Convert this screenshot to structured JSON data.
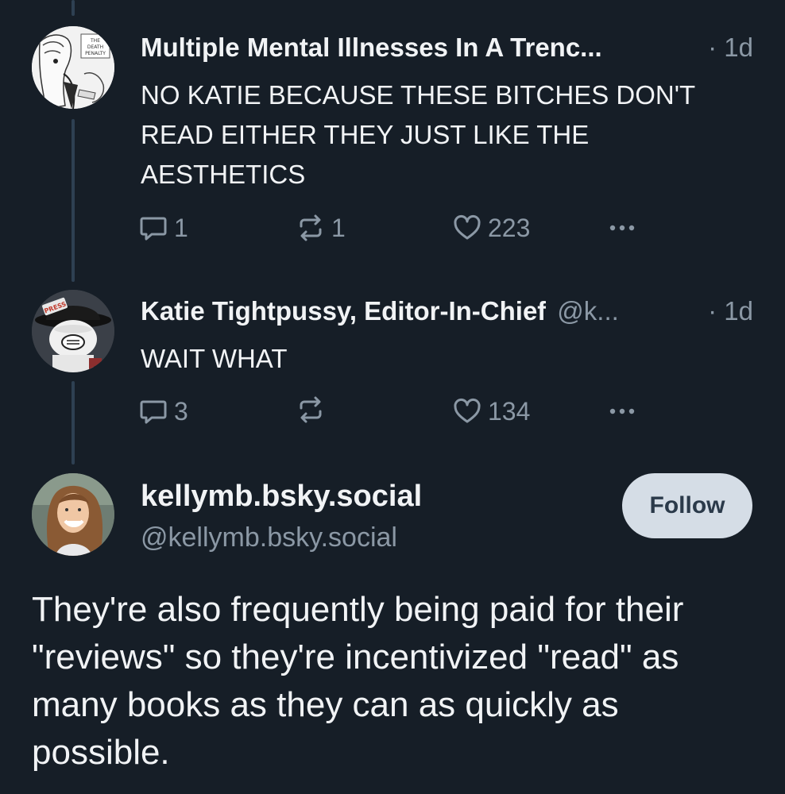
{
  "posts": [
    {
      "author": "Multiple Mental Illnesses In A Trenc...",
      "handle": "",
      "time": "· 1d",
      "text": "NO KATIE BECAUSE THESE BITCHES DON'T READ EITHER THEY JUST LIKE THE AESTHETICS",
      "replies": "1",
      "reposts": "1",
      "likes": "223",
      "avatar_label": "THE DEATH PENALTY"
    },
    {
      "author": "Katie Tightpussy, Editor-In-Chief",
      "handle": "@k...",
      "time": "· 1d",
      "text": "WAIT WHAT",
      "replies": "3",
      "reposts": "",
      "likes": "134",
      "avatar_label": "PRESS"
    }
  ],
  "main_post": {
    "display_name": "kellymb.bsky.social",
    "handle": "@kellymb.bsky.social",
    "follow_label": "Follow",
    "text": "They're also frequently being paid for their \"reviews\" so they're incentivized \"read\" as many books as they can as quickly as possible."
  },
  "icons": {
    "reply": "reply-icon",
    "repost": "repost-icon",
    "like": "heart-icon",
    "more": "more-icon"
  },
  "colors": {
    "background": "#161e27",
    "muted": "#8b98a5",
    "follow_bg": "#d5dde6"
  }
}
